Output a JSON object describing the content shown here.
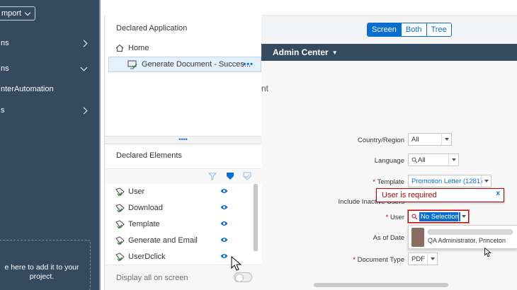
{
  "sidebar": {
    "import_label": "mport",
    "items": [
      {
        "label": "ns",
        "chevron": "right"
      },
      {
        "label": "ns",
        "chevron": "down"
      },
      {
        "label": "nterAutomation",
        "chevron": ""
      },
      {
        "label": "s",
        "chevron": "right"
      }
    ],
    "drop_hint_line1": "e here to add it to your",
    "drop_hint_line2": "project."
  },
  "toolbar": {
    "undo_icon": "undo-icon",
    "redo_icon": "redo-icon"
  },
  "declared_application": {
    "title": "Declared Application",
    "home_label": "Home",
    "selected_item": "Generate Document - Succes...",
    "more_label": "•••"
  },
  "splitter_label": "••••",
  "declared_elements": {
    "title": "Declared Elements",
    "items": [
      "User",
      "Download",
      "Template",
      "Generate and Email",
      "UserDclick"
    ],
    "display_all_label": "Display all on screen"
  },
  "view_switch": {
    "options": [
      "Screen",
      "Both",
      "Tree"
    ],
    "selected": "Screen"
  },
  "app": {
    "title": "Admin Center",
    "page_fragment": "nt",
    "form": {
      "country_label": "Country/Region",
      "country_value": "All",
      "language_label": "Language",
      "language_value": "All",
      "template_label": "Template",
      "template_value": "Promotion Letter (1281)",
      "inactive_label": "Include Inactive Users",
      "user_label": "User",
      "user_value": "No Selection",
      "asof_label": "As of Date",
      "doctype_label": "Document Type",
      "doctype_value": "PDF",
      "required_mark": "*"
    },
    "error_message": "User is required",
    "error_close": "x",
    "suggestion_name": "QA Administrator, Princeton"
  },
  "colors": {
    "sidebar_bg": "#354a5f",
    "accent": "#0a6ed1",
    "error": "#bb0000"
  }
}
